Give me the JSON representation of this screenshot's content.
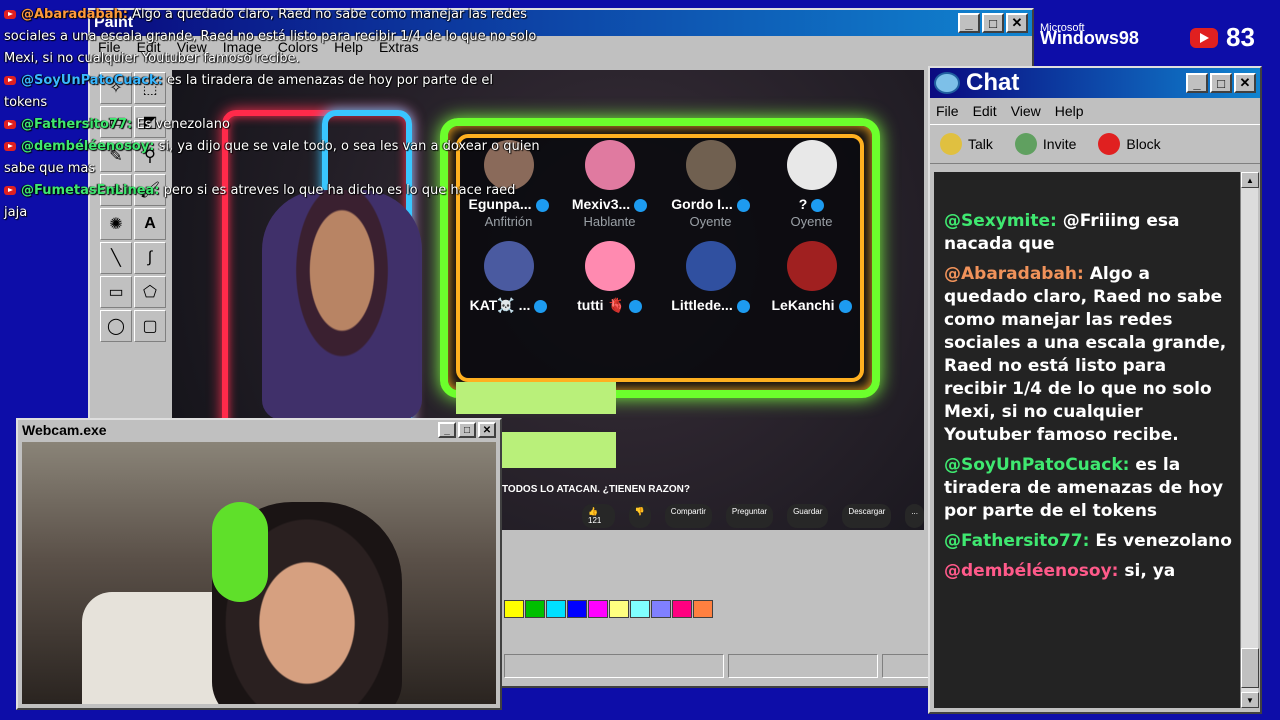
{
  "overlay": {
    "messages": [
      {
        "user": "@Abaradabah:",
        "color": "orange",
        "text": "Algo a quedado claro, Raed no sabe como manejar las redes sociales a una escala grande, Raed no está listo para recibir 1/4 de lo que no solo Mexi, si no cualquier Youtuber famoso recibe."
      },
      {
        "user": "@SoyUnPatoCuack:",
        "color": "blue",
        "text": "es la tiradera de amenazas de hoy por parte de el tokens"
      },
      {
        "user": "@Fathersito77:",
        "color": "green",
        "text": "Es venezolano"
      },
      {
        "user": "@dembéléenosoy:",
        "color": "green",
        "text": "si, ya dijo que se vale todo, o sea les van a doxear o quien sabe que mas"
      },
      {
        "user": "@FumetasEnLinea:",
        "color": "green",
        "text": "pero si es atreves lo que ha dicho es lo que hace raed jaja"
      }
    ]
  },
  "paint": {
    "title": "Paint",
    "menu": [
      "File",
      "Edit",
      "View",
      "Image",
      "Colors",
      "Help",
      "Extras"
    ],
    "palette": [
      "#ffff00",
      "#00c000",
      "#00e0ff",
      "#0000ff",
      "#ff00ff",
      "#ffff80",
      "#80ffff",
      "#8080ff",
      "#ff0080",
      "#ff8040"
    ]
  },
  "spaces": {
    "participants": [
      {
        "name": "Egunpa...",
        "role": "Anfitrión"
      },
      {
        "name": "Mexiv3...",
        "role": "Hablante"
      },
      {
        "name": "Gordo I...",
        "role": "Oyente"
      },
      {
        "name": "?",
        "role": "Oyente"
      },
      {
        "name": "KAT☠️ ...",
        "role": ""
      },
      {
        "name": "tutti 🫀",
        "role": ""
      },
      {
        "name": "Littlede...",
        "role": ""
      },
      {
        "name": "LeKanchi",
        "role": ""
      }
    ],
    "video_title": "TODOS LO ATACAN. ¿TIENEN RAZON?",
    "actions": [
      "👍 121",
      "👎",
      "Compartir",
      "Preguntar",
      "Guardar",
      "Descargar",
      "..."
    ]
  },
  "webcam": {
    "title": "Webcam.exe"
  },
  "taskbar": {
    "ms_small": "Microsoft",
    "win98": "Windows98",
    "yt_count": "83"
  },
  "chat": {
    "title": "Chat",
    "menu": [
      "File",
      "Edit",
      "View",
      "Help"
    ],
    "tools": [
      "Talk",
      "Invite",
      "Block"
    ],
    "messages": [
      {
        "user": "@Sexymite:",
        "color": "green",
        "text": "@Friiing esa nacada que"
      },
      {
        "user": "@Abaradabah:",
        "color": "orange",
        "text": "Algo a quedado claro, Raed no sabe como manejar las redes sociales a una escala grande, Raed no está listo para recibir 1/4 de lo que no solo Mexi, si no cualquier Youtuber famoso recibe."
      },
      {
        "user": "@SoyUnPatoCuack:",
        "color": "green",
        "text": "es la tiradera de amenazas de hoy por parte de el tokens"
      },
      {
        "user": "@Fathersito77:",
        "color": "green",
        "text": "Es venezolano"
      },
      {
        "user": "@dembéléenosoy:",
        "color": "pink",
        "text": "si, ya"
      }
    ]
  }
}
